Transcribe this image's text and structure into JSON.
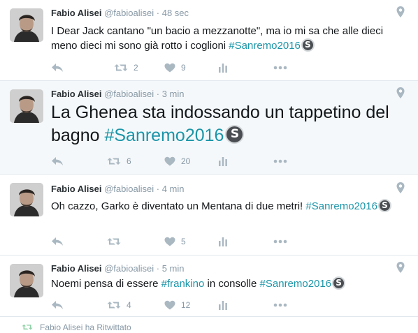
{
  "tweets": [
    {
      "name": "Fabio Alisei",
      "handle": "@fabioalisei",
      "separator": "·",
      "time": "48 sec",
      "text_before": "I Dear Jack cantano \"un bacio a mezzanotte\", ma io mi sa che alle dieci meno dieci mi sono già rotto i coglioni ",
      "hashtag": "#Sanremo2016",
      "badge": "S",
      "retweets": "2",
      "likes": "9"
    },
    {
      "name": "Fabio Alisei",
      "handle": "@fabioalisei",
      "separator": "·",
      "time": "3 min",
      "text_before": "La Ghenea sta indossando un tappetino del bagno ",
      "hashtag": "#Sanremo2016",
      "badge": "S",
      "retweets": "6",
      "likes": "20"
    },
    {
      "name": "Fabio Alisei",
      "handle": "@fabioalisei",
      "separator": "·",
      "time": "4 min",
      "text_before": "Oh cazzo, Garko è diventato un Mentana di due metri! ",
      "hashtag": "#Sanremo2016",
      "badge": "S",
      "retweets": "",
      "likes": "5"
    },
    {
      "name": "Fabio Alisei",
      "handle": "@fabioalisei",
      "separator": "·",
      "time": "5 min",
      "text_before": "Noemi pensa di essere ",
      "hashtag_1": "#frankino",
      "text_middle": " in consolle ",
      "hashtag": "#Sanremo2016",
      "badge": "S",
      "retweets": "4",
      "likes": "12"
    }
  ],
  "footer": {
    "retweeted_text": "Fabio Alisei ha Ritwittato"
  },
  "colors": {
    "hashtag": "#1b95a8",
    "highlight_bg": "#f5f8fa",
    "icon_gray": "#aab8c2",
    "border": "#e1e8ed"
  },
  "icons": [
    "location-pin-icon",
    "reply-icon",
    "retweet-icon",
    "like-heart-icon",
    "analytics-icon",
    "more-dots-icon",
    "sanremo-badge-icon"
  ]
}
